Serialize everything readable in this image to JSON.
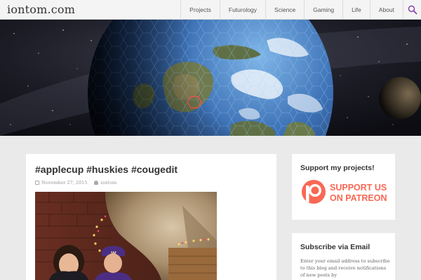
{
  "site": {
    "title": "iontom.com"
  },
  "nav": {
    "items": [
      {
        "label": "Projects"
      },
      {
        "label": "Futurology"
      },
      {
        "label": "Science"
      },
      {
        "label": "Gaming"
      },
      {
        "label": "Life"
      },
      {
        "label": "About"
      }
    ],
    "search_icon": "search-icon"
  },
  "post": {
    "title": "#applecup #huskies #cougedit",
    "date": "November 27, 2015",
    "author": "iontom"
  },
  "sidebar": {
    "support": {
      "title": "Support my projects!",
      "badge_line1": "SUPPORT US",
      "badge_line2": "ON PATREON",
      "badge_color": "#f96854"
    },
    "subscribe": {
      "title": "Subscribe via Email",
      "text": "Enter your email address to subscribe to this blog and receive notifications of new posts by"
    }
  },
  "colors": {
    "accent": "#8e44ad",
    "header_bg": "#f4f4f4",
    "page_bg": "#eaeaea"
  }
}
